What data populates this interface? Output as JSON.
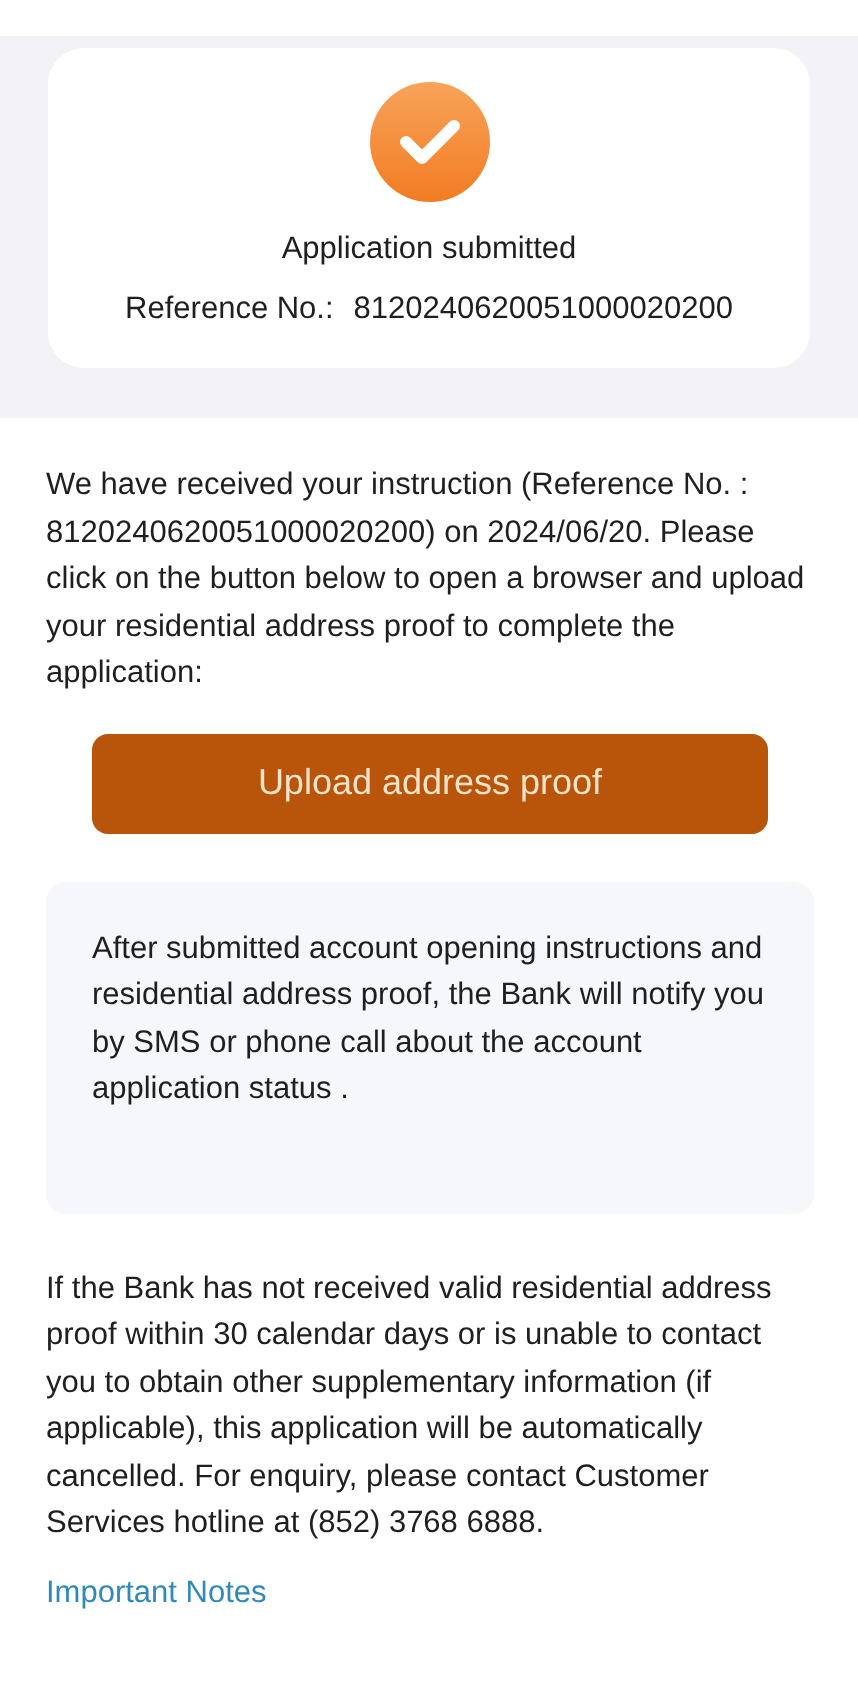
{
  "status_card": {
    "title": "Application submitted",
    "reference_label": "Reference No.:",
    "reference_value": "8120240620051000020200"
  },
  "instruction": "We have received your instruction (Reference No. : 8120240620051000020200) on 2024/06/20. Please click on the button below to open a browser and upload your residential address proof to complete the application:",
  "upload_button": "Upload address proof",
  "info_box": "After submitted account opening instructions and residential address proof, the Bank will notify you by SMS or phone call about the account application status .",
  "notice": "If the Bank has not received valid residential address proof within 30 calendar days or is unable to contact you to obtain other supplementary information (if applicable), this application will be automatically cancelled. For enquiry, please contact Customer Services hotline at (852) 3768 6888.",
  "important_notes_link": "Important Notes"
}
